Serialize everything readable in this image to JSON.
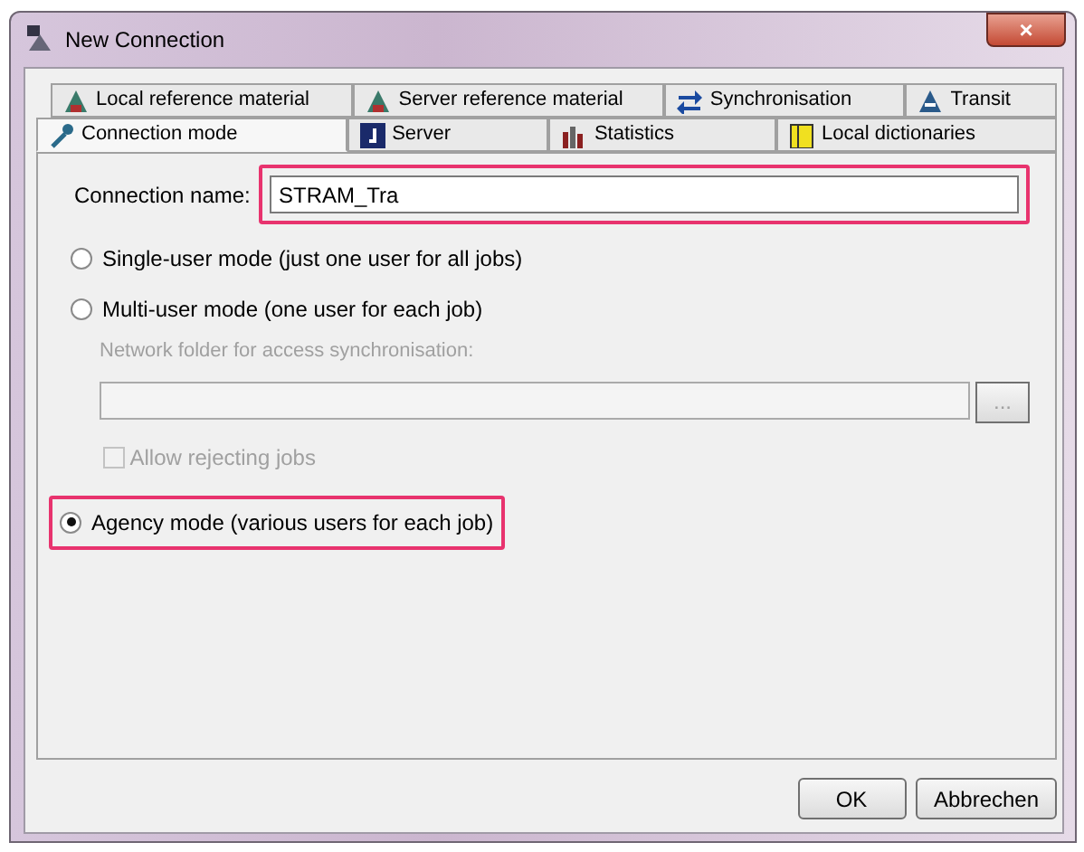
{
  "window": {
    "title": "New Connection",
    "close": "×"
  },
  "tab_rows": [
    {
      "tabs": [
        {
          "label": "Local reference material",
          "selected": false
        },
        {
          "label": "Server reference material",
          "selected": false
        },
        {
          "label": "Synchronisation",
          "selected": false
        },
        {
          "label": "Transit",
          "selected": false
        }
      ]
    },
    {
      "tabs": [
        {
          "label": "Connection mode",
          "selected": true
        },
        {
          "label": "Server",
          "selected": false
        },
        {
          "label": "Statistics",
          "selected": false
        },
        {
          "label": "Local dictionaries",
          "selected": false
        }
      ]
    }
  ],
  "connection_name": {
    "label": "Connection name:",
    "value": "STRAM_Tra",
    "highlighted": true
  },
  "modes": [
    {
      "kind": "radio",
      "label": "Single-user mode (just one user for all jobs)",
      "selected": false,
      "highlighted": false
    },
    {
      "kind": "radio",
      "label": "Multi-user mode (one user for each job)",
      "selected": false,
      "highlighted": false
    },
    {
      "kind": "folder",
      "label": "Network folder for access synchronisation:",
      "browse": "...",
      "disabled": true
    },
    {
      "kind": "checkbox",
      "label": "Allow rejecting jobs",
      "checked": false,
      "disabled": true
    },
    {
      "kind": "radio",
      "label": "Agency mode (various users for each job)",
      "selected": true,
      "highlighted": true
    }
  ],
  "buttons": [
    "OK",
    "Abbrechen"
  ]
}
